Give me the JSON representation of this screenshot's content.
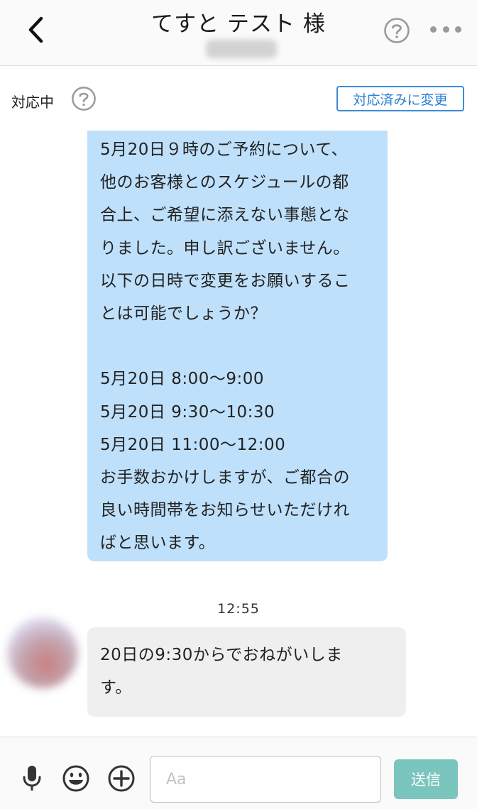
{
  "header": {
    "title": "てすと テスト 様",
    "back_icon": "chevron-left-icon",
    "help_icon": "question-circle-icon",
    "more_icon": "more-horizontal-icon"
  },
  "status": {
    "label": "対応中",
    "help_icon": "question-circle-icon",
    "change_button_label": "対応済みに変更",
    "accent_color": "#3b8cd9"
  },
  "messages": {
    "outgoing": {
      "lines": [
        "5月20日９時のご予約について、",
        "他のお客様とのスケジュールの都",
        "合上、ご希望に添えない事態とな",
        "りました。申し訳ございません。",
        "以下の日時で変更をお願いするこ",
        "とは可能でしょうか？",
        "",
        "5月20日 8:00〜9:00",
        "5月20日 9:30〜10:30",
        "5月20日 11:00〜12:00",
        "お手数おかけしますが、ご都合の",
        "良い時間帯をお知らせいただけれ",
        "ばと思います。"
      ],
      "bubble_color": "#bfe0fb"
    },
    "timestamp": "12:55",
    "incoming": {
      "lines": [
        "20日の9:30からでおねがいしま",
        "す。"
      ],
      "bubble_color": "#efefef"
    }
  },
  "input_bar": {
    "placeholder": "Aa",
    "send_label": "送信",
    "send_color": "#7ac5bd",
    "icons": [
      "microphone-icon",
      "smiley-icon",
      "plus-circle-icon"
    ]
  }
}
